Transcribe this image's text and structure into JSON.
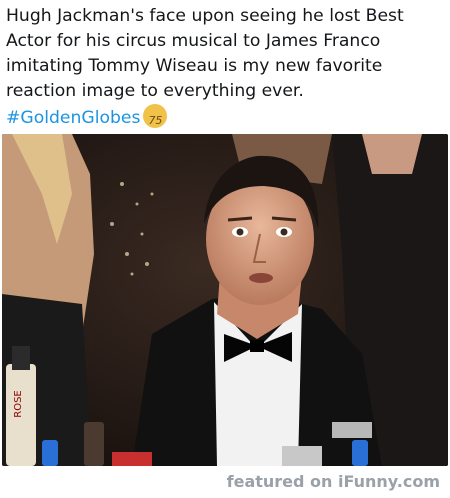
{
  "tweet": {
    "line1": "Hugh Jackman's face upon seeing he lost Best",
    "line2": "Actor for his circus musical to James Franco",
    "line3": "imitating Tommy Wiseau is my new favorite",
    "line4": "reaction image to everything ever.",
    "hashtag": "#GoldenGlobes",
    "badge_text": "75"
  },
  "photo": {
    "bottle_label": "ROSE"
  },
  "footer": {
    "featured": "featured on",
    "brand": "iFunny.com"
  }
}
